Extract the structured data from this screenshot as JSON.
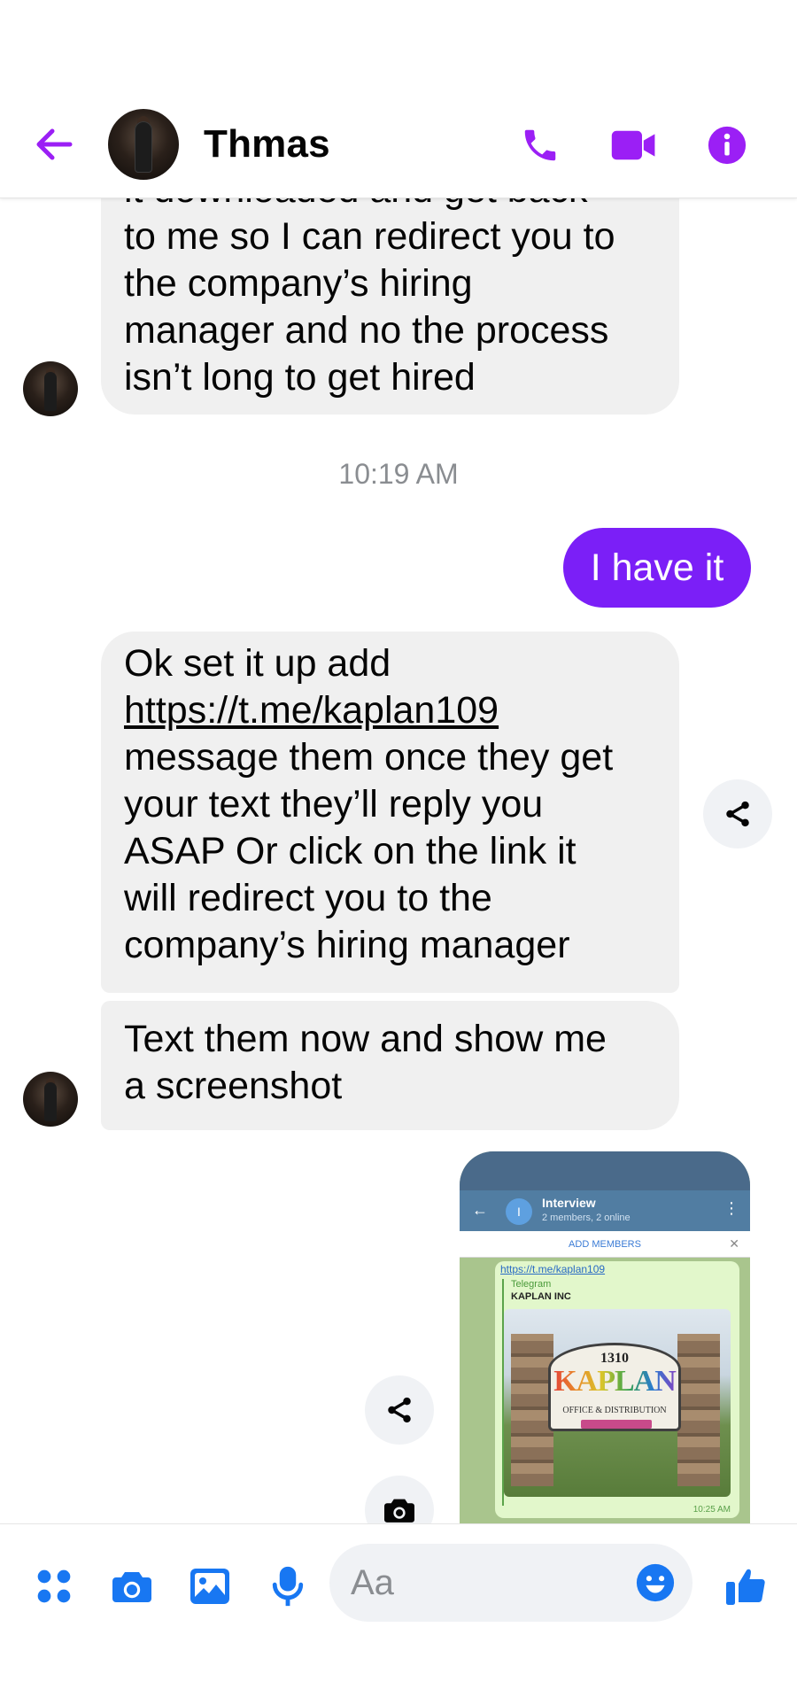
{
  "header": {
    "contact_name": "Thmas"
  },
  "messages": {
    "received_1_lines": [
      "it downloaded and get back",
      "to me so I can redirect you to",
      "the company’s hiring",
      "manager and no the process",
      "isn’t long to get hired"
    ],
    "timestamp": "10:19 AM",
    "sent_1": "I have it",
    "received_2_prefix": "Ok set it up add",
    "received_2_link": "https://t.me/kaplan109",
    "received_2_lines": [
      "message them once they get",
      "your text they’ll reply you",
      "ASAP  Or click on the link it",
      "will redirect you to the",
      "company’s hiring manager"
    ],
    "received_3_lines": [
      "Text them now and show me",
      "a screenshot"
    ]
  },
  "attachment": {
    "group_title": "Interview",
    "group_subtitle": "2 members, 2 online",
    "add_members": "ADD MEMBERS",
    "link": "https://t.me/kaplan109",
    "preview_site": "Telegram",
    "preview_title": "KAPLAN INC",
    "sign_number": "1310",
    "sign_word": "KAPLAN",
    "sign_sub": "OFFICE & DISTRIBUTION",
    "time": "10:25 AM"
  },
  "composer": {
    "placeholder": "Aa"
  },
  "colors": {
    "accent": "#7b1ff7",
    "composer_icon": "#1877f2",
    "bubble_received": "#f0f0f0"
  }
}
